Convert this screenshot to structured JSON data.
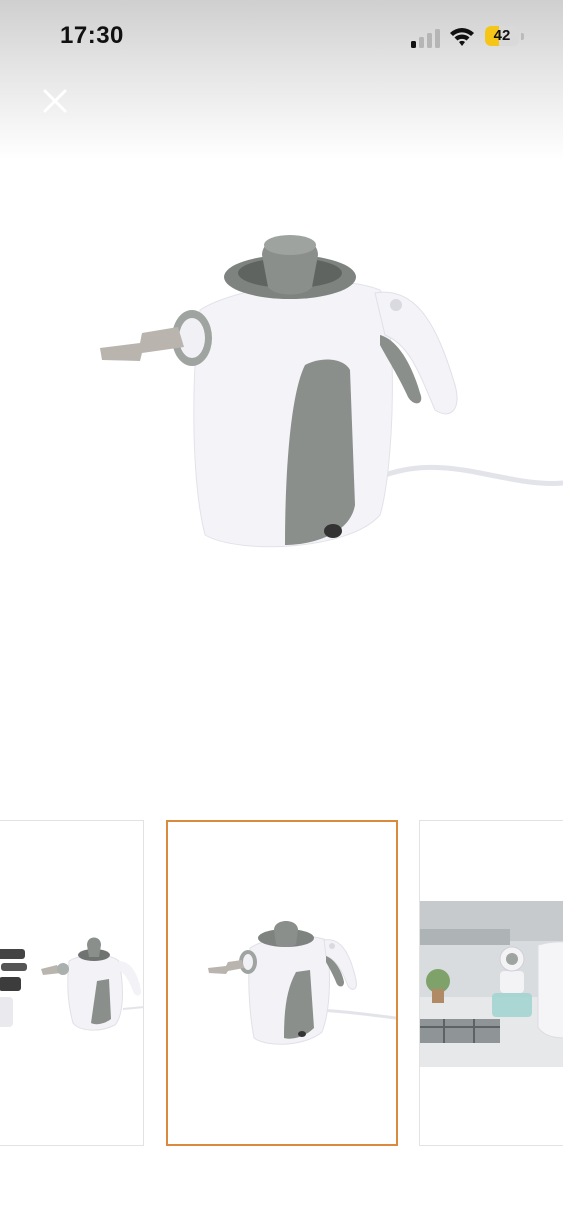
{
  "status_bar": {
    "time": "17:30",
    "battery_level": "42",
    "battery_fraction": 0.42,
    "signal_icon": "cellular-signal-icon",
    "wifi_icon": "wifi-icon"
  },
  "viewer": {
    "close_icon": "close-icon",
    "main_image": "hand-steam-cleaner-product-photo"
  },
  "thumbnails": [
    {
      "name": "thumbnail-accessories",
      "selected": false
    },
    {
      "name": "thumbnail-steam-cleaner",
      "selected": true
    },
    {
      "name": "thumbnail-kitchen-scene",
      "selected": false
    }
  ],
  "colors": {
    "selected_border": "#d98a3d",
    "battery_fill": "#f5c518",
    "product_gray": "#8a8f8b"
  }
}
